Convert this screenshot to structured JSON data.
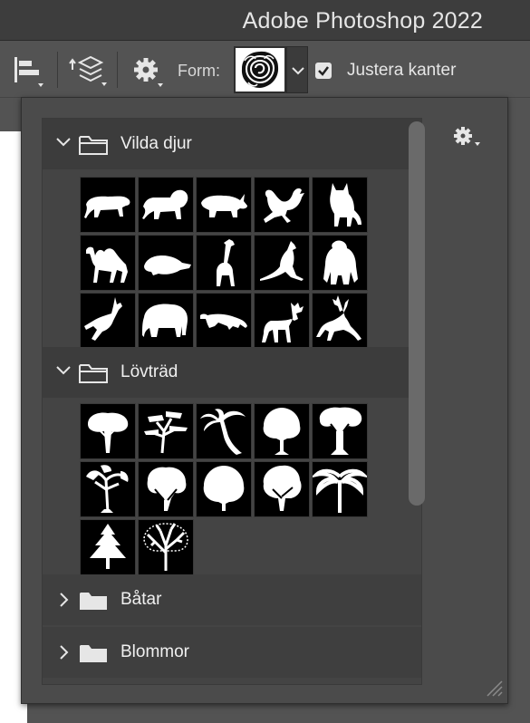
{
  "window": {
    "title": "Adobe Photoshop 2022"
  },
  "options_bar": {
    "form_label": "Form:",
    "preset_shape": "rose",
    "align_edges_label": "Justera kanter",
    "align_edges_checked": true,
    "icons": [
      "align-edges-icon",
      "arrange-layers-icon",
      "gear-icon",
      "chevron-down-icon"
    ]
  },
  "shape_picker": {
    "menu_icon": "gear-icon",
    "groups": [
      {
        "name": "Vilda djur",
        "expanded": true,
        "shapes": [
          "tiger",
          "lion",
          "rhino",
          "monkey",
          "fox",
          "camel",
          "beaver",
          "giraffe",
          "kangaroo",
          "gorilla",
          "gazelle",
          "elephant",
          "cheetah",
          "moose",
          "deer"
        ]
      },
      {
        "name": "Lövträd",
        "expanded": true,
        "shapes": [
          "tree-1",
          "tree-2",
          "palm-tree",
          "tree-3",
          "baobab",
          "tree-4",
          "tree-5",
          "tree-6",
          "tree-7",
          "palm-tree-2",
          "fir-tree",
          "bare-tree"
        ]
      },
      {
        "name": "Båtar",
        "expanded": false,
        "shapes": []
      },
      {
        "name": "Blommor",
        "expanded": false,
        "shapes": []
      }
    ]
  }
}
